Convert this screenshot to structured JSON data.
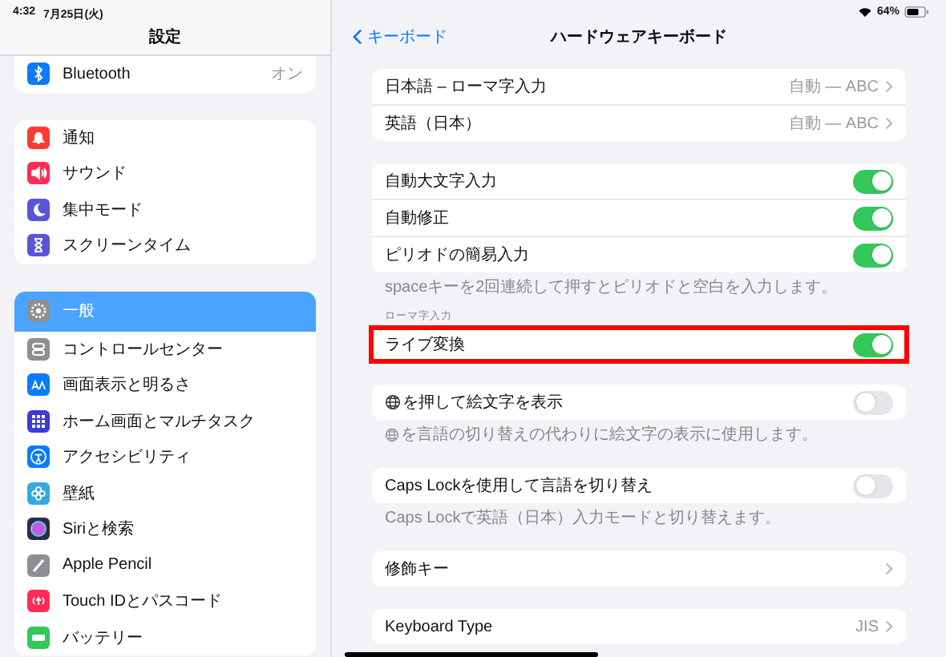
{
  "status_bar": {
    "time": "4:32",
    "date": "7月25日(火)",
    "battery": "64%"
  },
  "sidebar": {
    "title": "設定",
    "groups": [
      [
        {
          "label": "Bluetooth",
          "value": "オン",
          "color": "#0a7aff",
          "selected": false
        }
      ],
      [
        {
          "label": "通知",
          "color": "#ff3b30",
          "selected": false
        },
        {
          "label": "サウンド",
          "color": "#ff2d55",
          "selected": false
        },
        {
          "label": "集中モード",
          "color": "#5856d6",
          "selected": false
        },
        {
          "label": "スクリーンタイム",
          "color": "#5856d6",
          "selected": false
        }
      ],
      [
        {
          "label": "一般",
          "color": "#8e8e93",
          "selected": true
        },
        {
          "label": "コントロールセンター",
          "color": "#8e8e93",
          "selected": false
        },
        {
          "label": "画面表示と明るさ",
          "color": "#0a7aff",
          "selected": false
        },
        {
          "label": "ホーム画面とマルチタスク",
          "color": "#3a3ad6",
          "selected": false
        },
        {
          "label": "アクセシビリティ",
          "color": "#0a7aff",
          "selected": false
        },
        {
          "label": "壁紙",
          "color": "#35aadc",
          "selected": false
        },
        {
          "label": "Siriと検索",
          "color": "#2c2c4a",
          "selected": false
        },
        {
          "label": "Apple Pencil",
          "color": "#8e8e93",
          "selected": false
        },
        {
          "label": "Touch IDとパスコード",
          "color": "#ff2d55",
          "selected": false
        },
        {
          "label": "バッテリー",
          "color": "#34c759",
          "selected": false
        }
      ]
    ]
  },
  "detail": {
    "back": "キーボード",
    "title": "ハードウェアキーボード",
    "sections": [
      {
        "rows": [
          {
            "kind": "link",
            "label": "日本語 – ローマ字入力",
            "value": "自動 — ABC",
            "highlighted": false
          },
          {
            "kind": "link",
            "label": "英語（日本）",
            "value": "自動 — ABC",
            "highlighted": false
          }
        ]
      },
      {
        "rows": [
          {
            "kind": "toggle",
            "label": "自動大文字入力",
            "on": true,
            "highlighted": false
          },
          {
            "kind": "toggle",
            "label": "自動修正",
            "on": true,
            "highlighted": false
          },
          {
            "kind": "toggle",
            "label": "ピリオドの簡易入力",
            "on": true,
            "highlighted": false
          }
        ],
        "footer": "spaceキーを2回連続して押すとピリオドと空白を入力します。"
      },
      {
        "header": "ローマ字入力",
        "rows": [
          {
            "kind": "toggle",
            "label": "ライブ変換",
            "on": true,
            "highlighted": true
          }
        ]
      },
      {
        "rows": [
          {
            "kind": "toggle",
            "label": "を押して絵文字を表示",
            "globe": true,
            "on": false,
            "highlighted": false
          }
        ],
        "footer": "を言語の切り替えの代わりに絵文字の表示に使用します。",
        "footer_globe": true
      },
      {
        "rows": [
          {
            "kind": "toggle",
            "label": "Caps Lockを使用して言語を切り替え",
            "on": false,
            "highlighted": false
          }
        ],
        "footer": "Caps Lockで英語（日本）入力モードと切り替えます。"
      },
      {
        "rows": [
          {
            "kind": "link",
            "label": "修飾キー",
            "highlighted": false
          }
        ]
      },
      {
        "rows": [
          {
            "kind": "link",
            "label": "Keyboard Type",
            "value": "JIS",
            "highlighted": false
          }
        ]
      }
    ]
  }
}
